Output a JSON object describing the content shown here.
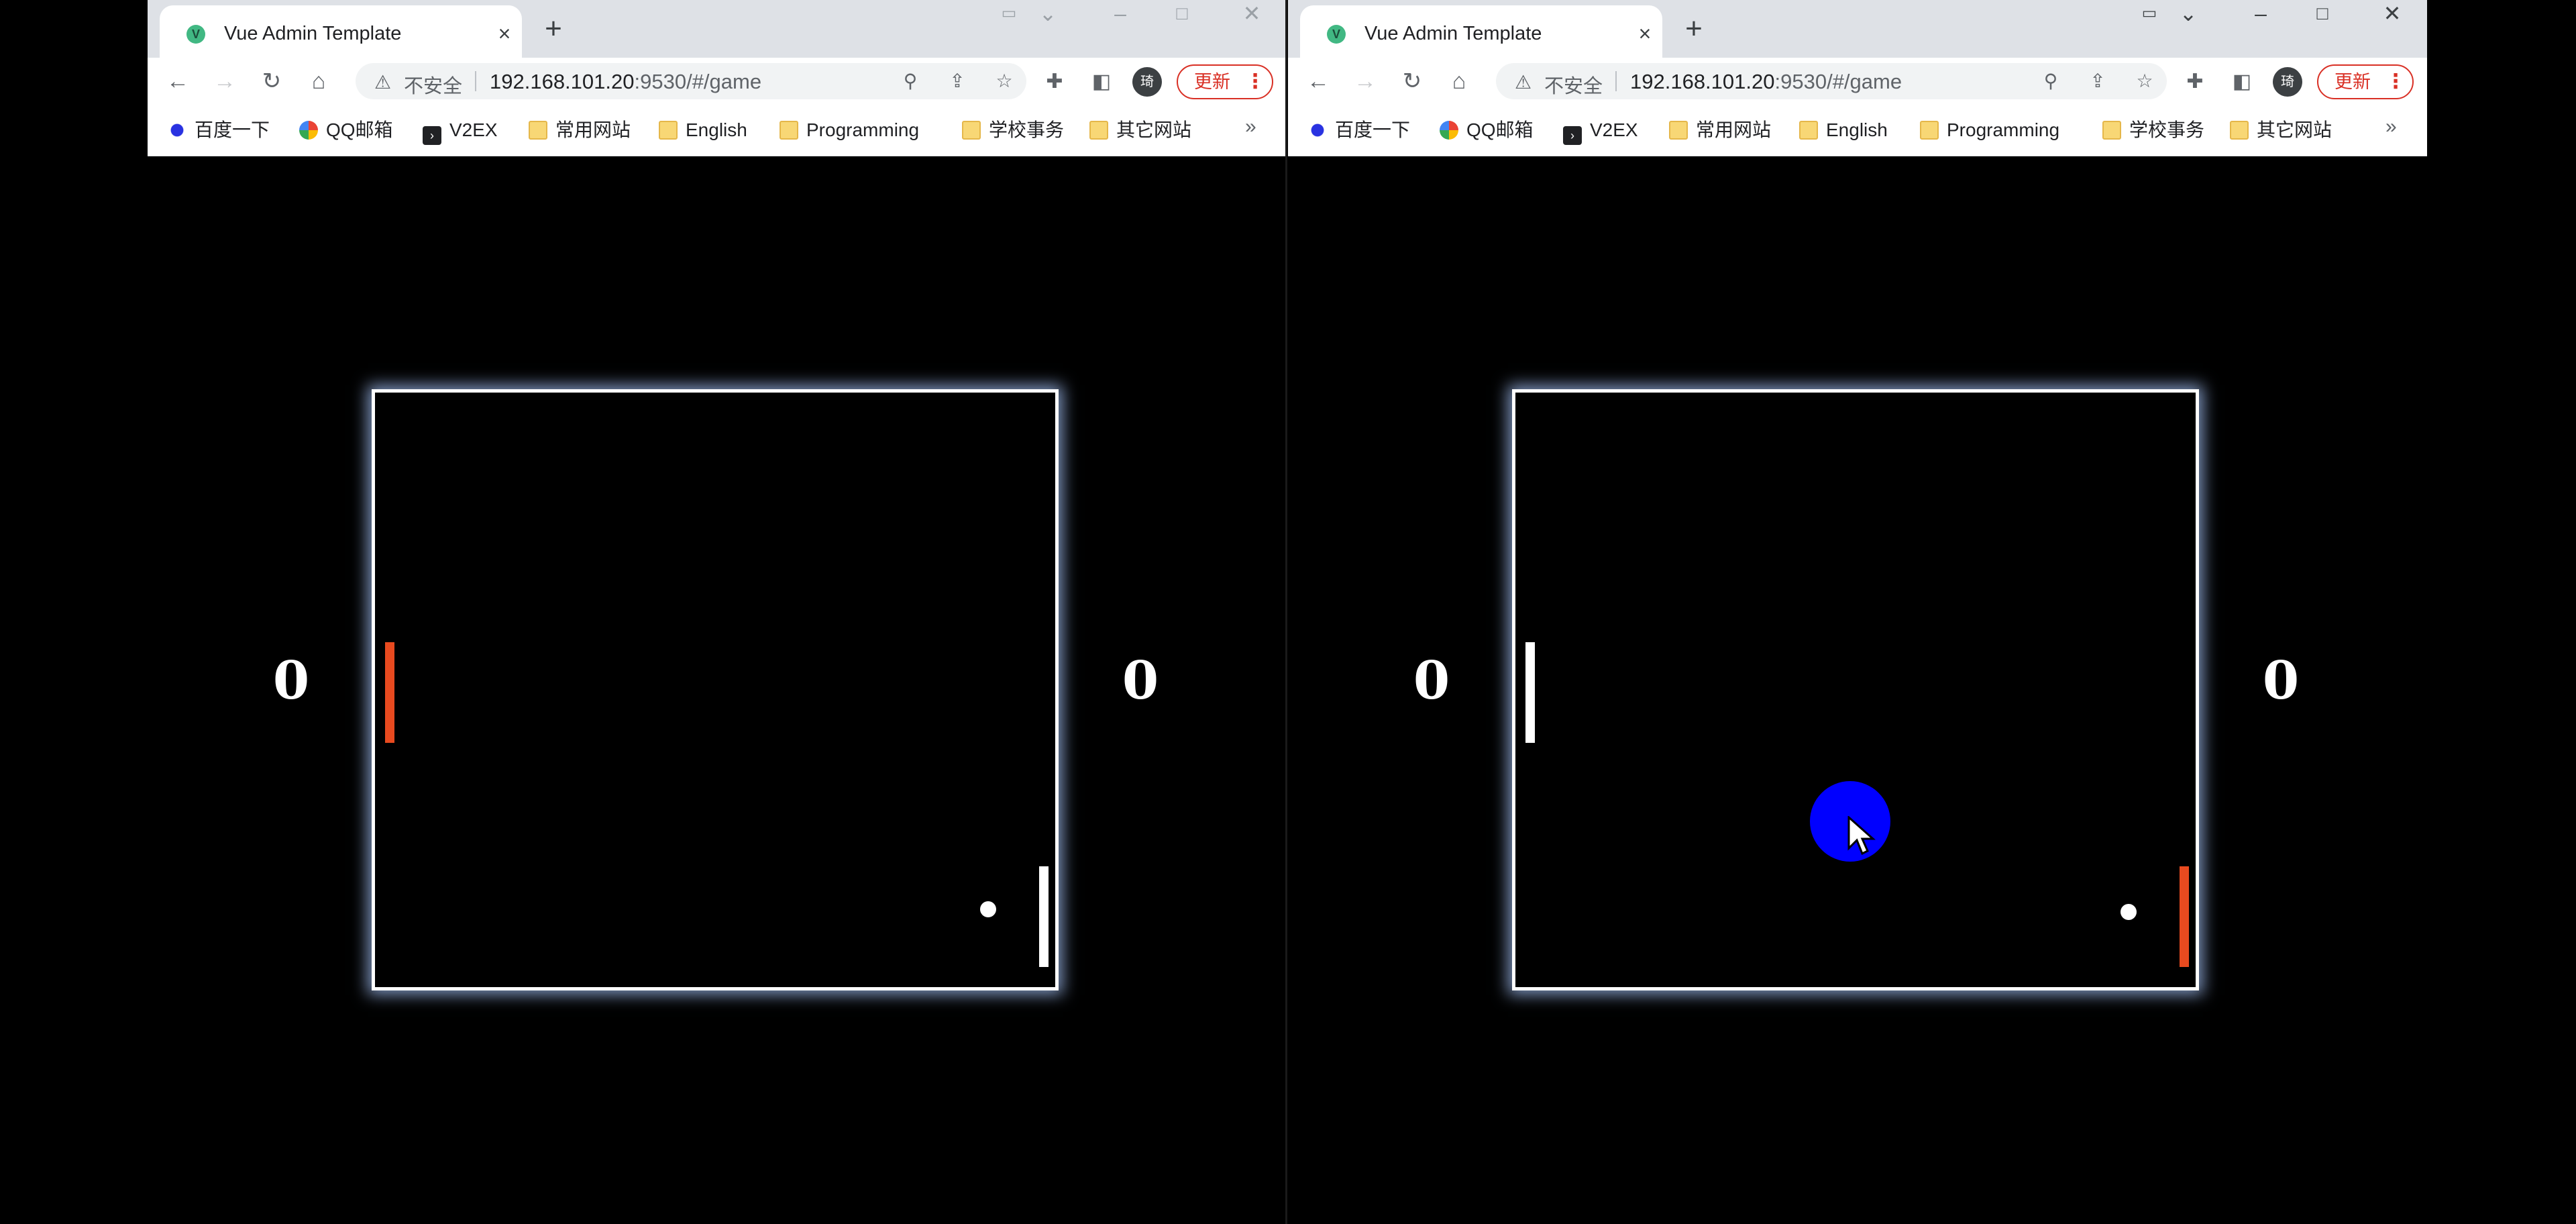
{
  "colors": {
    "paddle_active": "#e84a1f",
    "paddle_idle": "#ffffff",
    "board_glow": "#aac8ff",
    "cursor_highlight": "#0000ff"
  },
  "browser": {
    "tab_title": "Vue Admin Template",
    "favicon": "vue-icon",
    "security_label": "不安全",
    "url_host": "192.168.101.20",
    "url_rest": ":9530/#/game",
    "update_label": "更新",
    "profile_initial": "琦",
    "bookmarks": [
      "百度一下",
      "QQ邮箱",
      "V2EX",
      "常用网站",
      "English",
      "Programming",
      "学校事务",
      "其它网站"
    ],
    "bookmarks_overflow": "»"
  },
  "game": {
    "left_window": {
      "score_left": "0",
      "score_right": "0"
    },
    "right_window": {
      "score_left": "0",
      "score_right": "0"
    }
  }
}
